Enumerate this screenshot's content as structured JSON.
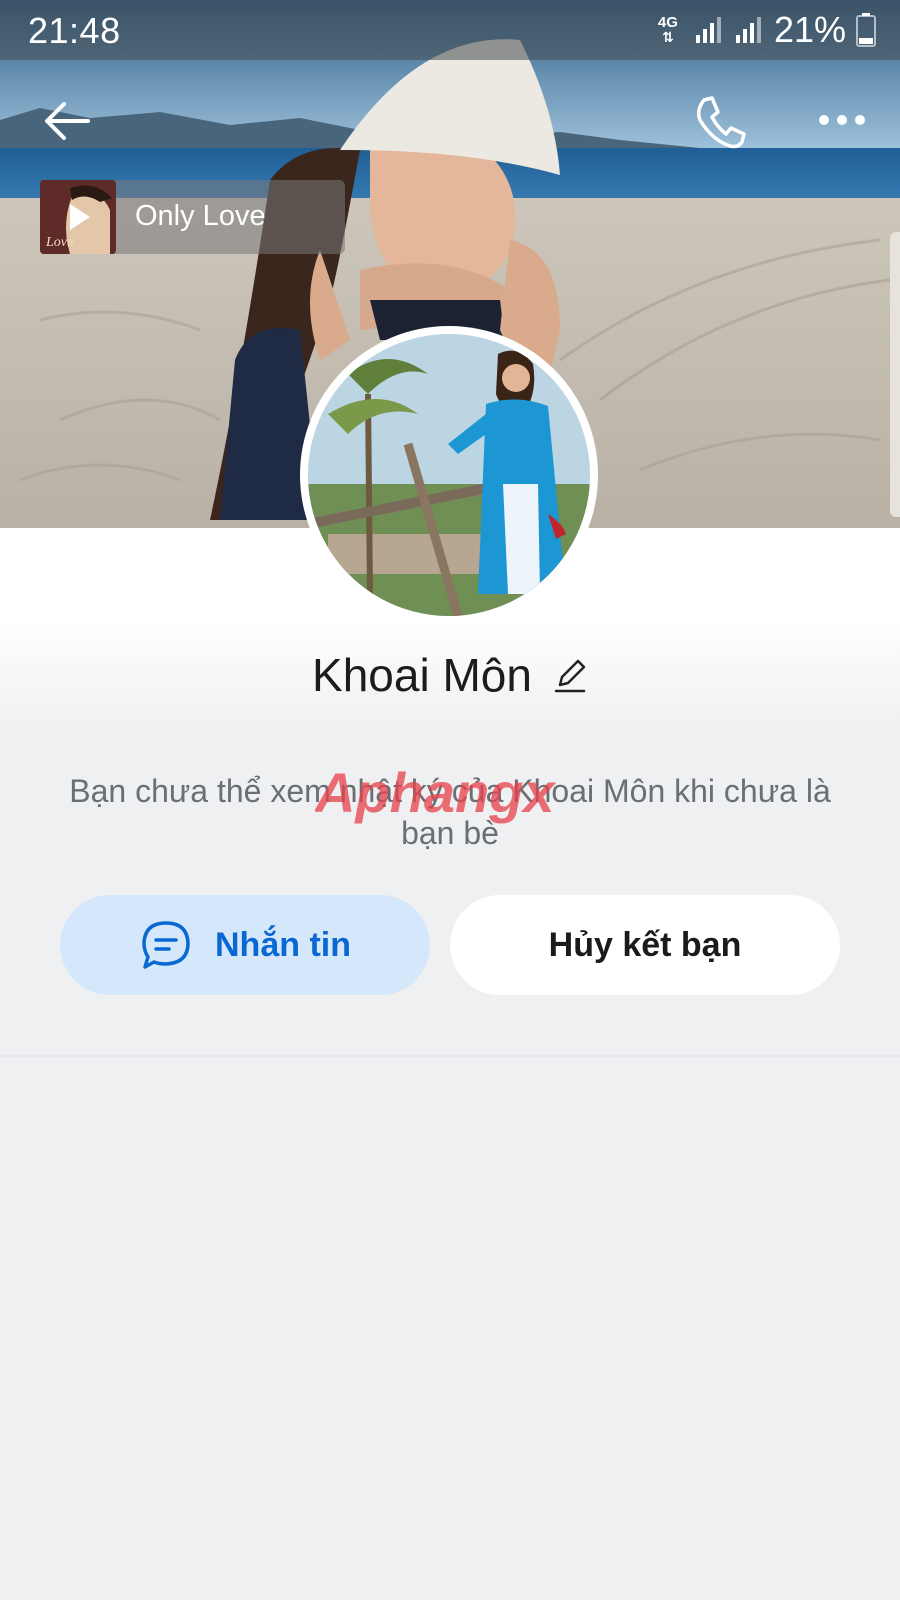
{
  "status_bar": {
    "time": "21:48",
    "network": "4G",
    "battery": "21%"
  },
  "cover": {
    "music": {
      "title": "Only Love"
    }
  },
  "profile": {
    "name": "Khoai Môn",
    "privacy_note": "Bạn chưa thể xem nhật ký của Khoai Môn khi chưa là bạn bè",
    "watermark": "Aphangx"
  },
  "actions": {
    "message_label": "Nhắn tin",
    "unfriend_label": "Hủy kết bạn"
  },
  "icons": {
    "back": "arrow-left-icon",
    "call": "phone-icon",
    "more": "more-icon",
    "edit": "pencil-icon",
    "message": "chat-bubble-icon"
  }
}
